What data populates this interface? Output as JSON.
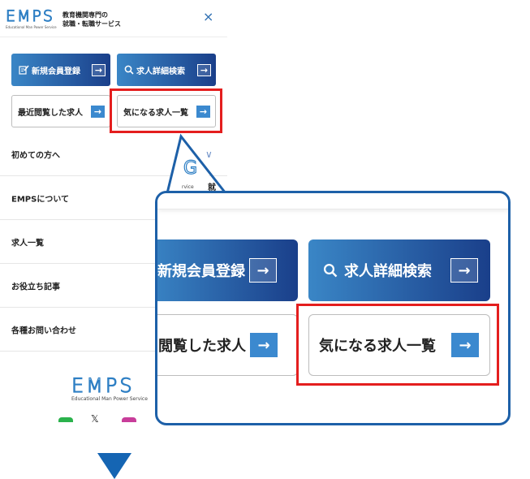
{
  "header": {
    "logo": "EMPS",
    "logo_sub": "Educational Man Power Service",
    "tagline_line1": "教育機関専門の",
    "tagline_line2": "就職・転職サービス",
    "close_glyph": "×"
  },
  "buttons": {
    "register": "新規会員登録",
    "search": "求人詳細検索",
    "recent": "最近閲覧した求人",
    "favorites": "気になる求人一覧",
    "arrow": "→",
    "register_icon": "edit-icon",
    "search_icon": "search-icon"
  },
  "nav": {
    "items": [
      {
        "label": "初めての方へ",
        "chevron": "∨"
      },
      {
        "label": "EMPSについて"
      },
      {
        "label": "求人一覧"
      },
      {
        "label": "お役立ち記事"
      },
      {
        "label": "各種お問い合わせ"
      }
    ]
  },
  "footer": {
    "logo": "EMPS",
    "logo_sub": "Educational Man Power Service"
  },
  "callout": {
    "register": "新規会員登録",
    "search": "求人詳細検索",
    "recent_partial": "閲覧した求人",
    "favorites": "気になる求人一覧",
    "arrow": "→",
    "peek_logo": "G",
    "peek_logo_sub": "rvice",
    "peek_tag": "就"
  },
  "colors": {
    "brand_blue": "#2e7fc4",
    "gradient_start": "#3a86c6",
    "gradient_end": "#1a3f8a",
    "highlight_red": "#e41e1e",
    "callout_border": "#1d60a8"
  }
}
